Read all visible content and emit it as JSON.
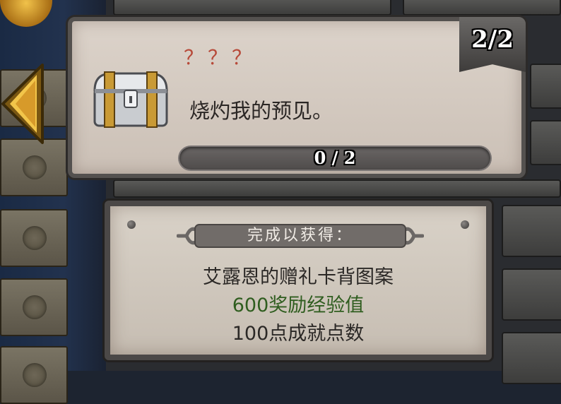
{
  "quest": {
    "title": "？？？",
    "description": "烧灼我的预见。",
    "page_counter": "2/2",
    "progress": {
      "text": "0 / 2",
      "current": 0,
      "total": 2
    }
  },
  "reward": {
    "header": "完成以获得：",
    "items": [
      "艾露恩的赠礼卡背图案",
      "600奖励经验值",
      "100点成就点数"
    ]
  },
  "colors": {
    "title_red": "#b74a3a",
    "xp_green": "#2f5d1f",
    "arrow_gold": "#e9b43a"
  }
}
